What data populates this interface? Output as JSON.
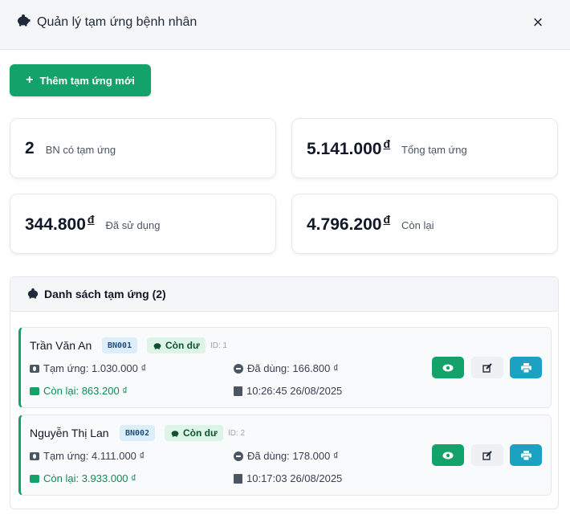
{
  "header": {
    "title": "Quản lý tạm ứng bệnh nhân",
    "icon": "piggy-bank-icon",
    "close_label": "×"
  },
  "add_button": {
    "plus": "+",
    "label": "Thêm tạm ứng mới"
  },
  "stats": {
    "patients": {
      "value": "2",
      "label": "BN có tạm ứng"
    },
    "total": {
      "value": "5.141.000",
      "currency": "đ",
      "label": "Tổng tạm ứng"
    },
    "used": {
      "value": "344.800",
      "currency": "đ",
      "label": "Đã sử dụng"
    },
    "remaining": {
      "value": "4.796.200",
      "currency": "đ",
      "label": "Còn lại"
    }
  },
  "list": {
    "title": "Danh sách tạm ứng (2)",
    "items": [
      {
        "name": "Trần Văn An",
        "code": "BN001",
        "status": "Còn dư",
        "id": "ID: 1",
        "advance": "Tạm ứng: 1.030.000 ₫",
        "used": "Đã dùng: 166.800 ₫",
        "remaining": "Còn lại: 863.200 ₫",
        "time": "10:26:45 26/08/2025"
      },
      {
        "name": "Nguyễn Thị Lan",
        "code": "BN002",
        "status": "Còn dư",
        "id": "ID: 2",
        "advance": "Tạm ứng: 4.111.000 ₫",
        "used": "Đã dùng: 178.000 ₫",
        "remaining": "Còn lại: 3.933.000 ₫",
        "time": "10:17:03 26/08/2025"
      }
    ]
  },
  "colors": {
    "primary": "#14a26b",
    "info": "#1ba1c1",
    "badge_code": "#dbeefa",
    "badge_status": "#dcf5e6"
  }
}
